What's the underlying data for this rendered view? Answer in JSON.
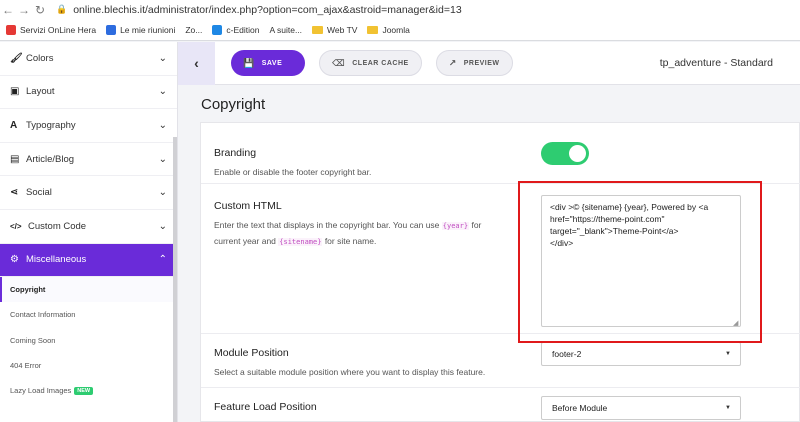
{
  "browser": {
    "url": "online.blechis.it/administrator/index.php?option=com_ajax&astroid=manager&id=13",
    "bookmarks": [
      {
        "label": "Servizi OnLine Hera",
        "color": "#e53935"
      },
      {
        "label": "Le mie riunioni",
        "color": "#2d6cdf"
      },
      {
        "label": "Zo...",
        "color": "#555555"
      },
      {
        "label": "c-Edition",
        "color": "#1e88e5"
      },
      {
        "label": "A suite...",
        "color": "#777777"
      },
      {
        "label": "Web TV",
        "color": "#f1c232"
      },
      {
        "label": "Joomla",
        "color": "#f1c232"
      }
    ]
  },
  "sidebar": {
    "items": [
      {
        "label": "Colors",
        "icon": "paint-brush-icon",
        "glyph": "🖌"
      },
      {
        "label": "Layout",
        "icon": "layout-icon",
        "glyph": "▣"
      },
      {
        "label": "Typography",
        "icon": "font-icon",
        "glyph": "A"
      },
      {
        "label": "Article/Blog",
        "icon": "article-icon",
        "glyph": "▤"
      },
      {
        "label": "Social",
        "icon": "share-icon",
        "glyph": "⋖"
      },
      {
        "label": "Custom Code",
        "icon": "code-icon",
        "glyph": "</>"
      },
      {
        "label": "Miscellaneous",
        "icon": "cogs-icon",
        "glyph": "⚙"
      }
    ],
    "subitems": [
      {
        "label": "Copyright"
      },
      {
        "label": "Contact Information"
      },
      {
        "label": "Coming Soon"
      },
      {
        "label": "404 Error"
      },
      {
        "label": "Lazy Load Images",
        "badge": "NEW"
      }
    ]
  },
  "toolbar": {
    "save_label": "SAVE",
    "clear_cache_label": "CLEAR CACHE",
    "preview_label": "PREVIEW",
    "template_name": "tp_adventure - Standard"
  },
  "page": {
    "title": "Copyright"
  },
  "fields": {
    "branding": {
      "label": "Branding",
      "desc": "Enable or disable the footer copyright bar.",
      "enabled": true
    },
    "custom_html": {
      "label": "Custom HTML",
      "desc_1": "Enter the text that displays in the copyright bar. You can use",
      "code_year": "{year}",
      "desc_2": "for",
      "desc_3": "current year and",
      "code_sitename": "{sitename}",
      "desc_4": "for site name.",
      "value": "<div >© {sitename} {year}, Powered by <a\nhref=\"https://theme-point.com\"\ntarget=\"_blank\">Theme-Point</a>\n</div>"
    },
    "module_position": {
      "label": "Module Position",
      "desc": "Select a suitable module position where you want to display this feature.",
      "value": "footer-2"
    },
    "feature_load_position": {
      "label": "Feature Load Position",
      "value": "Before Module"
    }
  },
  "colors": {
    "accent": "#6a2bd9",
    "toggle_on": "#2ecc71",
    "highlight": "#e0191b"
  }
}
